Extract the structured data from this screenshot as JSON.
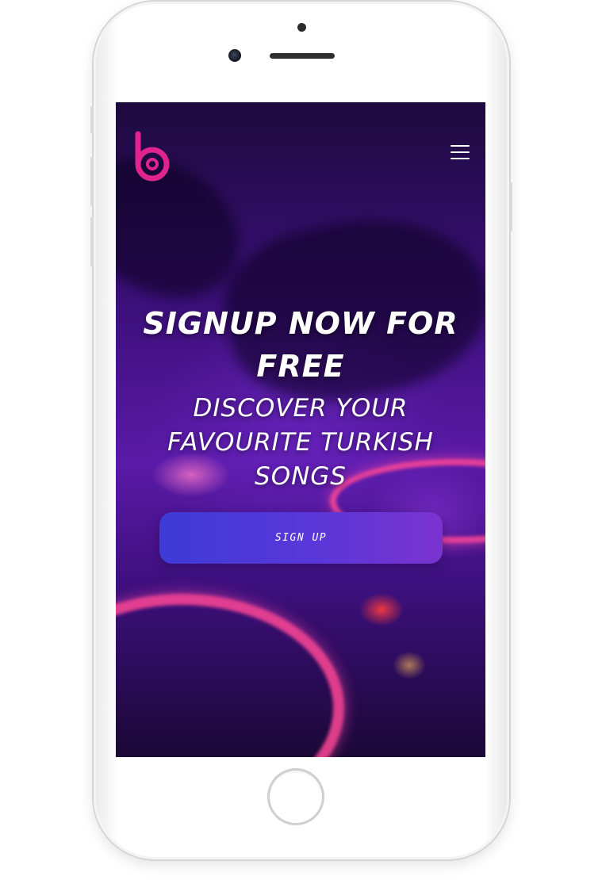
{
  "header": {
    "logo_icon": "brand-logo-icon",
    "menu_icon": "hamburger-menu-icon"
  },
  "hero": {
    "headline": "SIGNUP NOW FOR FREE",
    "subheadline": "DISCOVER YOUR FAVOURITE TURKISH SONGS",
    "cta_label": "SIGN UP"
  },
  "colors": {
    "brand_accent": "#e0238f",
    "button_start": "#3d3bd6",
    "button_end": "#7a33cf",
    "text": "#ffffff"
  }
}
